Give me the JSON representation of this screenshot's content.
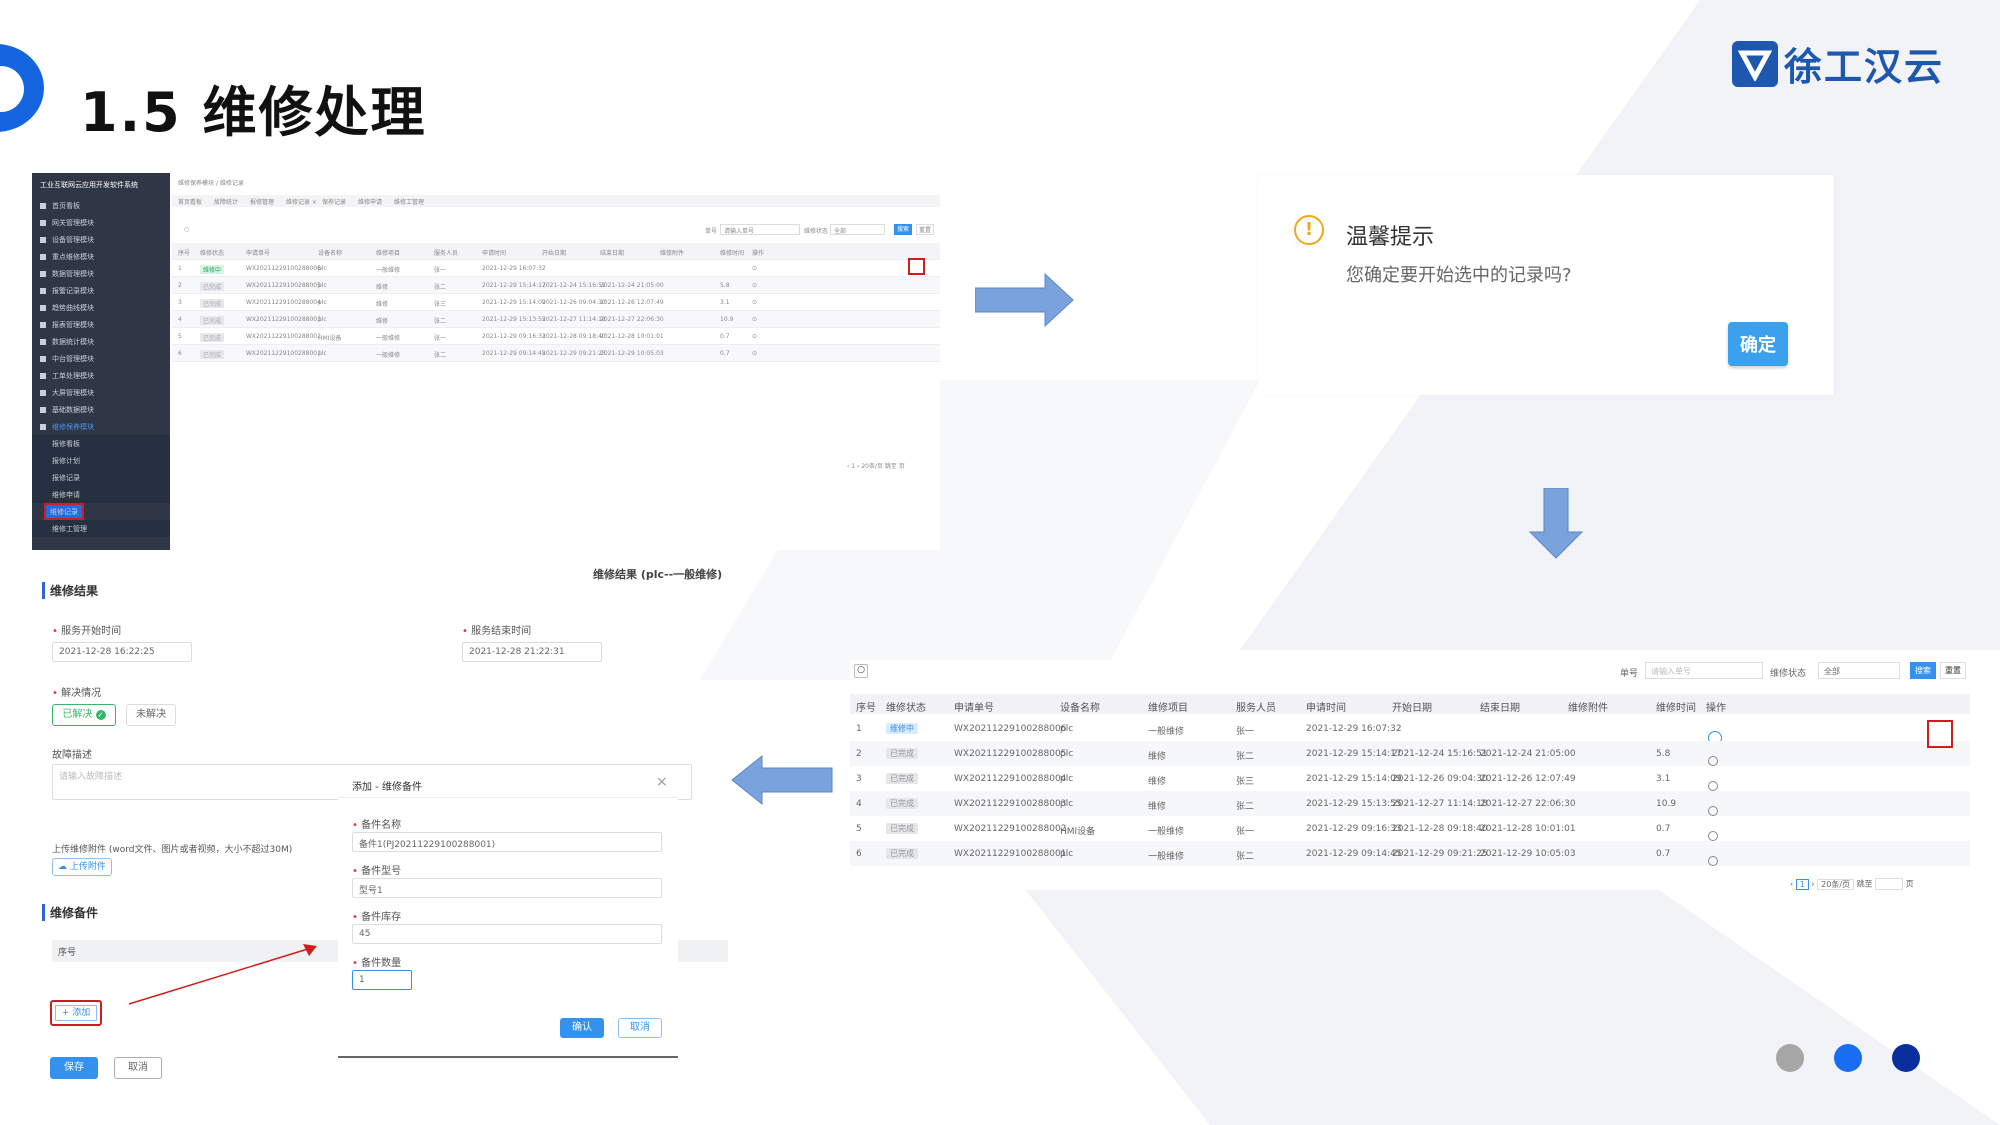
{
  "page": {
    "title": "1.5 维修处理",
    "logo_text": "徐工汉云"
  },
  "screenshot1": {
    "app_title": "工业互联网云应用开发软件系统",
    "breadcrumb": "维修保养模块 / 维修记录",
    "tabs": [
      "首页看板",
      "故障统计",
      "报修管理",
      "维修记录 ×",
      "保养记录",
      "维修申请",
      "维修工管理"
    ],
    "filter": {
      "label_no": "单号",
      "placeholder_no": "请输入单号",
      "label_status": "维修状态",
      "status_value": "全部",
      "search": "搜索",
      "reset": "重置"
    },
    "sidebar": [
      {
        "label": "首页看板"
      },
      {
        "label": "网关管理模块"
      },
      {
        "label": "设备管理模块"
      },
      {
        "label": "重点维修模块"
      },
      {
        "label": "数据管理模块"
      },
      {
        "label": "报警记录模块"
      },
      {
        "label": "趋势曲线模块"
      },
      {
        "label": "报表管理模块"
      },
      {
        "label": "数据统计模块"
      },
      {
        "label": "中台管理模块"
      },
      {
        "label": "工单处理模块"
      },
      {
        "label": "大屏管理模块"
      },
      {
        "label": "基础数据模块"
      },
      {
        "label": "维修保养模块"
      }
    ],
    "sidebar_sub": [
      "报修看板",
      "报修计划",
      "报修记录",
      "维修申请",
      "维修记录",
      "维修工管理"
    ],
    "columns": [
      "序号",
      "维修状态",
      "申请单号",
      "设备名称",
      "维修项目",
      "服务人员",
      "申请时间",
      "开始日期",
      "结束日期",
      "维修附件",
      "维修时间",
      "操作"
    ],
    "rows": [
      [
        "1",
        "维修中",
        "WX20211229100288006",
        "plc",
        "一般维修",
        "张一",
        "2021-12-29 16:07:32",
        "",
        "",
        "",
        "",
        ""
      ],
      [
        "2",
        "已完成",
        "WX20211229100288005",
        "plc",
        "维修",
        "张二",
        "2021-12-29 15:14:17",
        "2021-12-24 15:16:51",
        "2021-12-24 21:05:00",
        "",
        "5.8",
        ""
      ],
      [
        "3",
        "已完成",
        "WX20211229100288004",
        "plc",
        "维修",
        "张三",
        "2021-12-29 15:14:09",
        "2021-12-26 09:04:30",
        "2021-12-26 12:07:49",
        "",
        "3.1",
        ""
      ],
      [
        "4",
        "已完成",
        "WX20211229100288003",
        "plc",
        "维修",
        "张二",
        "2021-12-29 15:13:55",
        "2021-12-27 11:14:18",
        "2021-12-27 22:06:30",
        "",
        "10.9",
        ""
      ],
      [
        "5",
        "已完成",
        "WX20211229100288002",
        "HMI设备",
        "一般维修",
        "张一",
        "2021-12-29 09:16:33",
        "2021-12-28 09:18:40",
        "2021-12-28 10:01:01",
        "",
        "0.7",
        ""
      ],
      [
        "6",
        "已完成",
        "WX20211229100288001",
        "plc",
        "一般维修",
        "张二",
        "2021-12-29 09:14:45",
        "2021-12-29 09:21:25",
        "2021-12-29 10:05:03",
        "",
        "0.7",
        ""
      ]
    ]
  },
  "dialog": {
    "title": "温馨提示",
    "message": "您确定要开始选中的记录吗?",
    "confirm": "确定"
  },
  "list": {
    "filter": {
      "label_no": "单号",
      "placeholder_no": "请输入单号",
      "label_status": "维修状态",
      "status_value": "全部",
      "search": "搜索",
      "reset": "重置"
    },
    "columns": [
      "序号",
      "维修状态",
      "申请单号",
      "设备名称",
      "维修项目",
      "服务人员",
      "申请时间",
      "开始日期",
      "结束日期",
      "维修附件",
      "维修时间",
      "操作"
    ],
    "pagination": {
      "page": "1",
      "page_size": "20条/页",
      "goto": "跳至",
      "page_suffix": "页"
    }
  },
  "form": {
    "heading": "维修结果 (plc--一般维修)",
    "section_result": "维修结果",
    "start_label": "服务开始时间",
    "start_value": "2021-12-28 16:22:25",
    "end_label": "服务结束时间",
    "end_value": "2021-12-28 21:22:31",
    "resolve_label": "解决情况",
    "resolved": "已解决",
    "unresolved": "未解决",
    "desc_label": "故障描述",
    "desc_placeholder": "请输入故障描述",
    "attach_hint": "上传维修附件 (word文件、图片或者视频，大小不超过30M)",
    "upload": "上传附件",
    "section_parts": "维修备件",
    "parts_col": "序号",
    "add": "+ 添加",
    "save": "保存",
    "cancel": "取消"
  },
  "modal": {
    "title": "添加 - 维修备件",
    "name_label": "备件名称",
    "name_value": "备件1(PJ20211229100288001)",
    "model_label": "备件型号",
    "model_value": "型号1",
    "stock_label": "备件库存",
    "stock_value": "45",
    "qty_label": "备件数量",
    "qty_value": "1",
    "ok": "确认",
    "cancel": "取消"
  },
  "colors": {
    "accent": "#1565e0",
    "logo": "#1d57ae",
    "highlight": "#d01e1e",
    "button": "#3591ee"
  },
  "dots": [
    "#a6a6a6",
    "#1a6cf0",
    "#0a2e9e"
  ]
}
